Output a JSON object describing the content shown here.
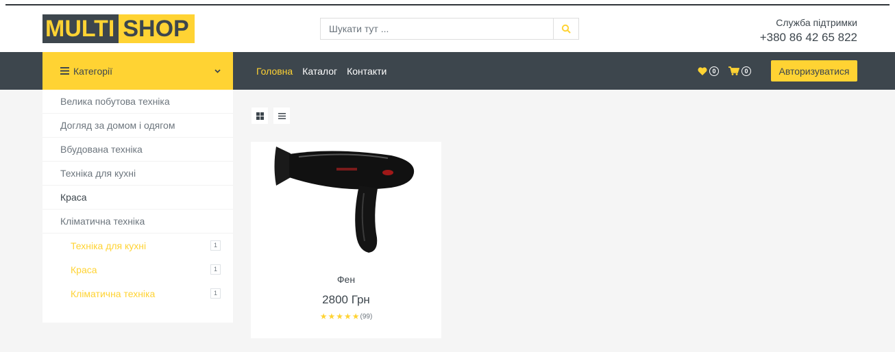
{
  "logo": {
    "part1": "MULTI",
    "part2": "SHOP"
  },
  "search": {
    "placeholder": "Шукати тут ..."
  },
  "support": {
    "label": "Служба підтримки",
    "phone": "+380 86 42 65 822"
  },
  "nav": {
    "categories_label": "Категорії",
    "links": [
      "Головна",
      "Каталог",
      "Контакти"
    ],
    "wishlist_count": "0",
    "cart_count": "0",
    "login_label": "Авторизуватися"
  },
  "sidebar": {
    "items": [
      "Велика побутова техніка",
      "Догляд за домом і одягом",
      "Вбудована техніка",
      "Техніка для кухні",
      "Краса",
      "Кліматична техніка"
    ],
    "sub_items": [
      {
        "label": "Техніка для кухні",
        "count": "1"
      },
      {
        "label": "Краса",
        "count": "1"
      },
      {
        "label": "Кліматична техніка",
        "count": "1"
      }
    ]
  },
  "product": {
    "name": "Фен",
    "price": "2800 Грн",
    "rating": 5,
    "reviews": "(99)"
  },
  "colors": {
    "accent": "#FFD333",
    "dark": "#3D464D",
    "background": "#F5F5F5"
  }
}
